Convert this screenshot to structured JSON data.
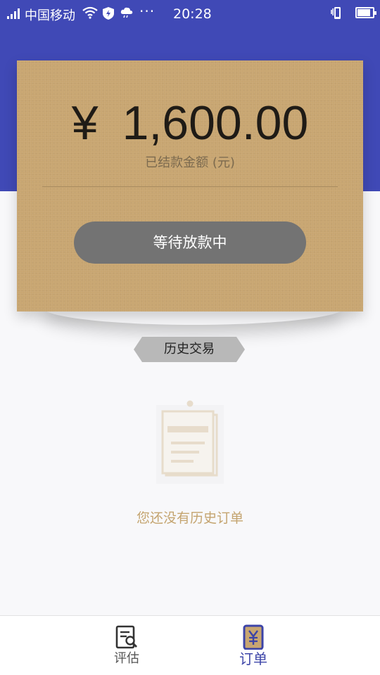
{
  "status_bar": {
    "carrier": "中国移动",
    "dots": "···",
    "time": "20:28",
    "battery_level": 0.85
  },
  "card": {
    "currency_symbol": "¥",
    "amount": "1,600.00",
    "amount_label": "已结款金额 (元)",
    "status_button_label": "等待放款中"
  },
  "history": {
    "tag_label": "历史交易",
    "empty_message": "您还没有历史订单"
  },
  "bottom_nav": {
    "items": [
      {
        "label": "评估",
        "icon": "evaluate-search-icon",
        "active": false
      },
      {
        "label": "订单",
        "icon": "yen-order-icon",
        "active": true
      }
    ]
  },
  "colors": {
    "header": "#4049b6",
    "card": "#c8a671",
    "button": "#737373",
    "empty_text": "#c4a46f",
    "active_nav": "#3c44a8"
  }
}
